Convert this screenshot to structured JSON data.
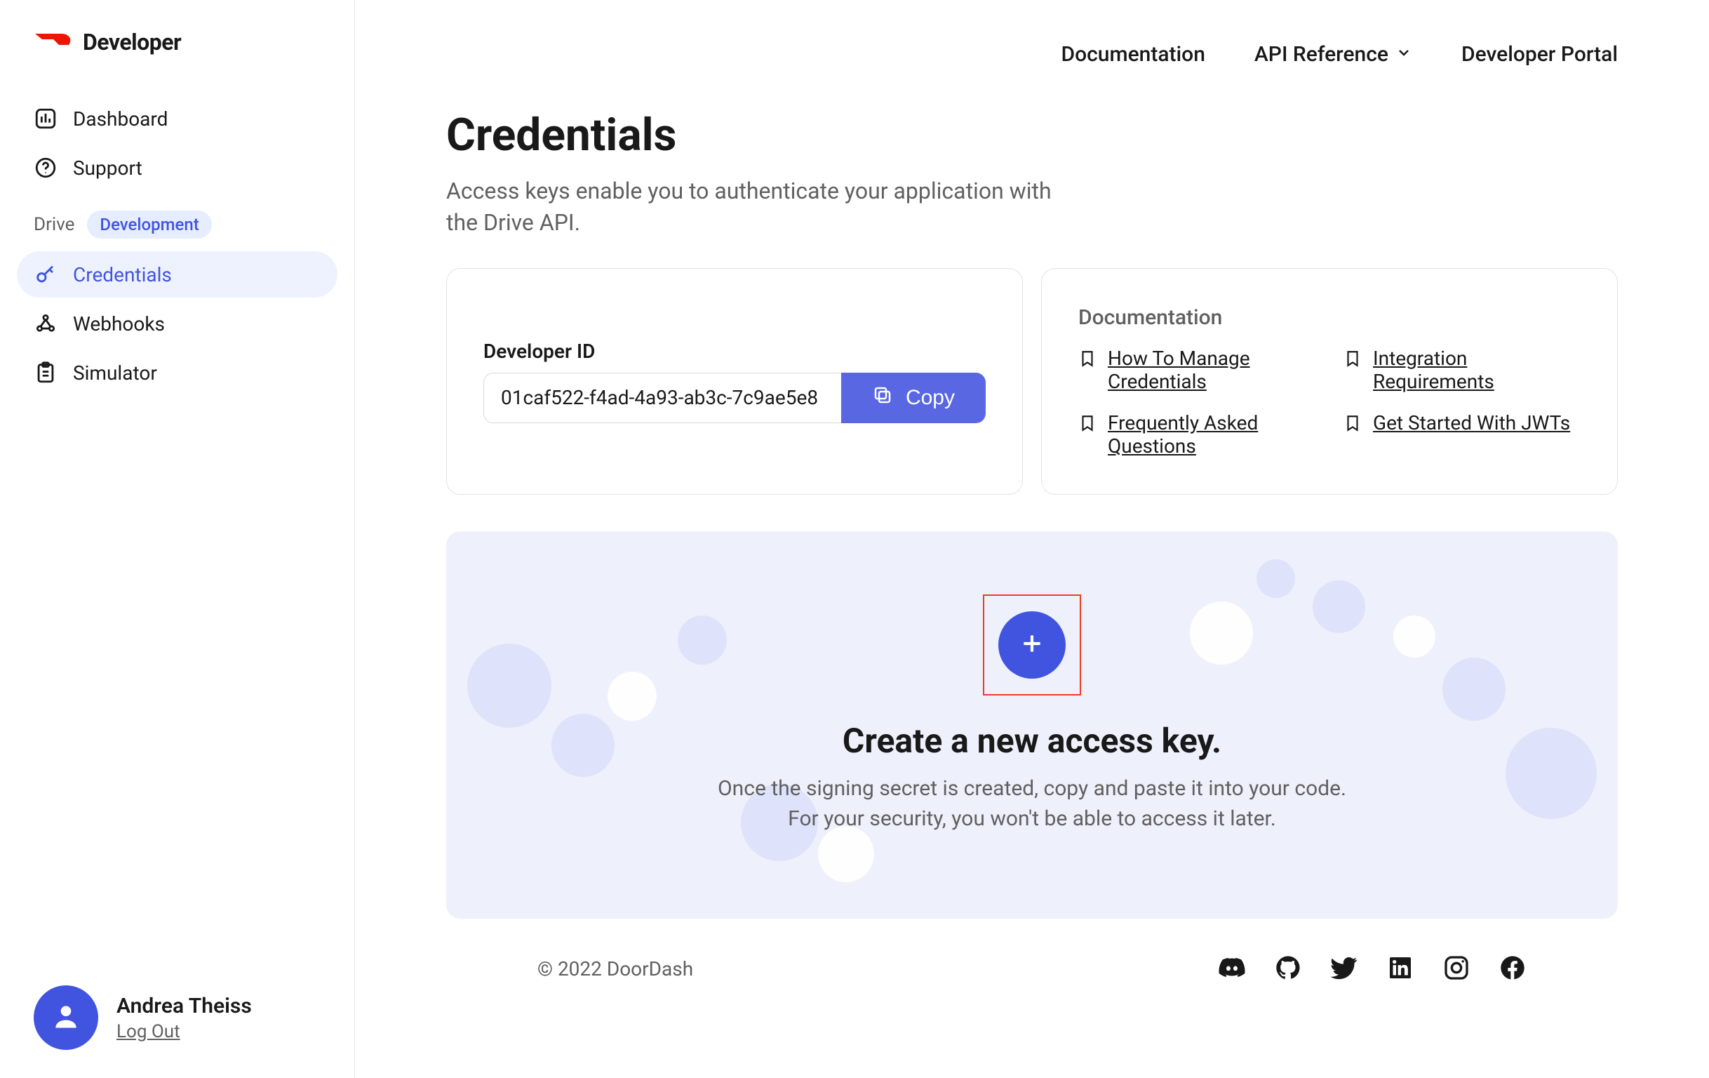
{
  "brand": {
    "name": "Developer"
  },
  "sidebar": {
    "nav_top": [
      {
        "id": "dashboard",
        "label": "Dashboard"
      },
      {
        "id": "support",
        "label": "Support"
      }
    ],
    "section": {
      "label": "Drive",
      "badge": "Development"
    },
    "nav_drive": [
      {
        "id": "credentials",
        "label": "Credentials",
        "active": true
      },
      {
        "id": "webhooks",
        "label": "Webhooks"
      },
      {
        "id": "simulator",
        "label": "Simulator"
      }
    ]
  },
  "topnav": {
    "documentation": "Documentation",
    "api_reference": "API Reference",
    "developer_portal": "Developer Portal"
  },
  "page": {
    "title": "Credentials",
    "description": "Access keys enable you to authenticate your application with the Drive API."
  },
  "developer_id": {
    "label": "Developer ID",
    "value": "01caf522-f4ad-4a93-ab3c-7c9ae5e8",
    "copy_label": "Copy"
  },
  "docs_card": {
    "title": "Documentation",
    "links": [
      "How To Manage Credentials",
      "Integration Requirements",
      "Frequently Asked Questions",
      "Get Started With JWTs"
    ]
  },
  "create_panel": {
    "title": "Create a new access key.",
    "description": "Once the signing secret is created, copy and paste it into your code. For your security, you won't be able to access it later."
  },
  "user": {
    "name": "Andrea Theiss",
    "logout": "Log Out"
  },
  "footer": {
    "copyright": "© 2022 DoorDash"
  }
}
